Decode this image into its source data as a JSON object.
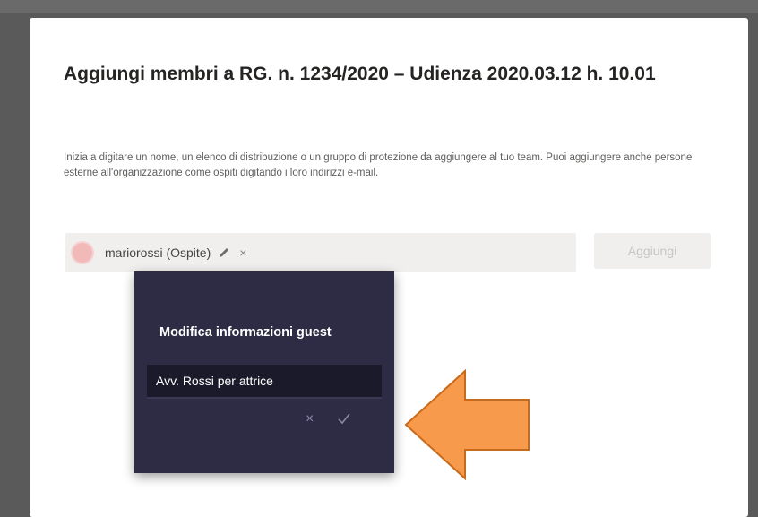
{
  "dialog": {
    "title": "Aggiungi membri a RG. n. 1234/2020 – Udienza 2020.03.12 h. 10.01",
    "description": "Inizia a digitare un nome, un elenco di distribuzione o un gruppo di protezione da aggiungere al tuo team. Puoi aggiungere anche persone esterne all'organizzazione come ospiti digitando i loro indirizzi e-mail."
  },
  "picker": {
    "chip_label": "mariorossi (Ospite)",
    "remove_glyph": "×",
    "add_button_label": "Aggiungi"
  },
  "popover": {
    "title": "Modifica informazioni guest",
    "guest_name_value": "Avv. Rossi per attrice",
    "cancel_glyph": "×"
  },
  "colors": {
    "accent_arrow": "#f79a4c",
    "popover_bg": "#2d2c44",
    "avatar": "#f2b9b9"
  },
  "icons": [
    "pencil-icon",
    "close-icon",
    "checkmark-icon",
    "arrow-left-icon"
  ]
}
